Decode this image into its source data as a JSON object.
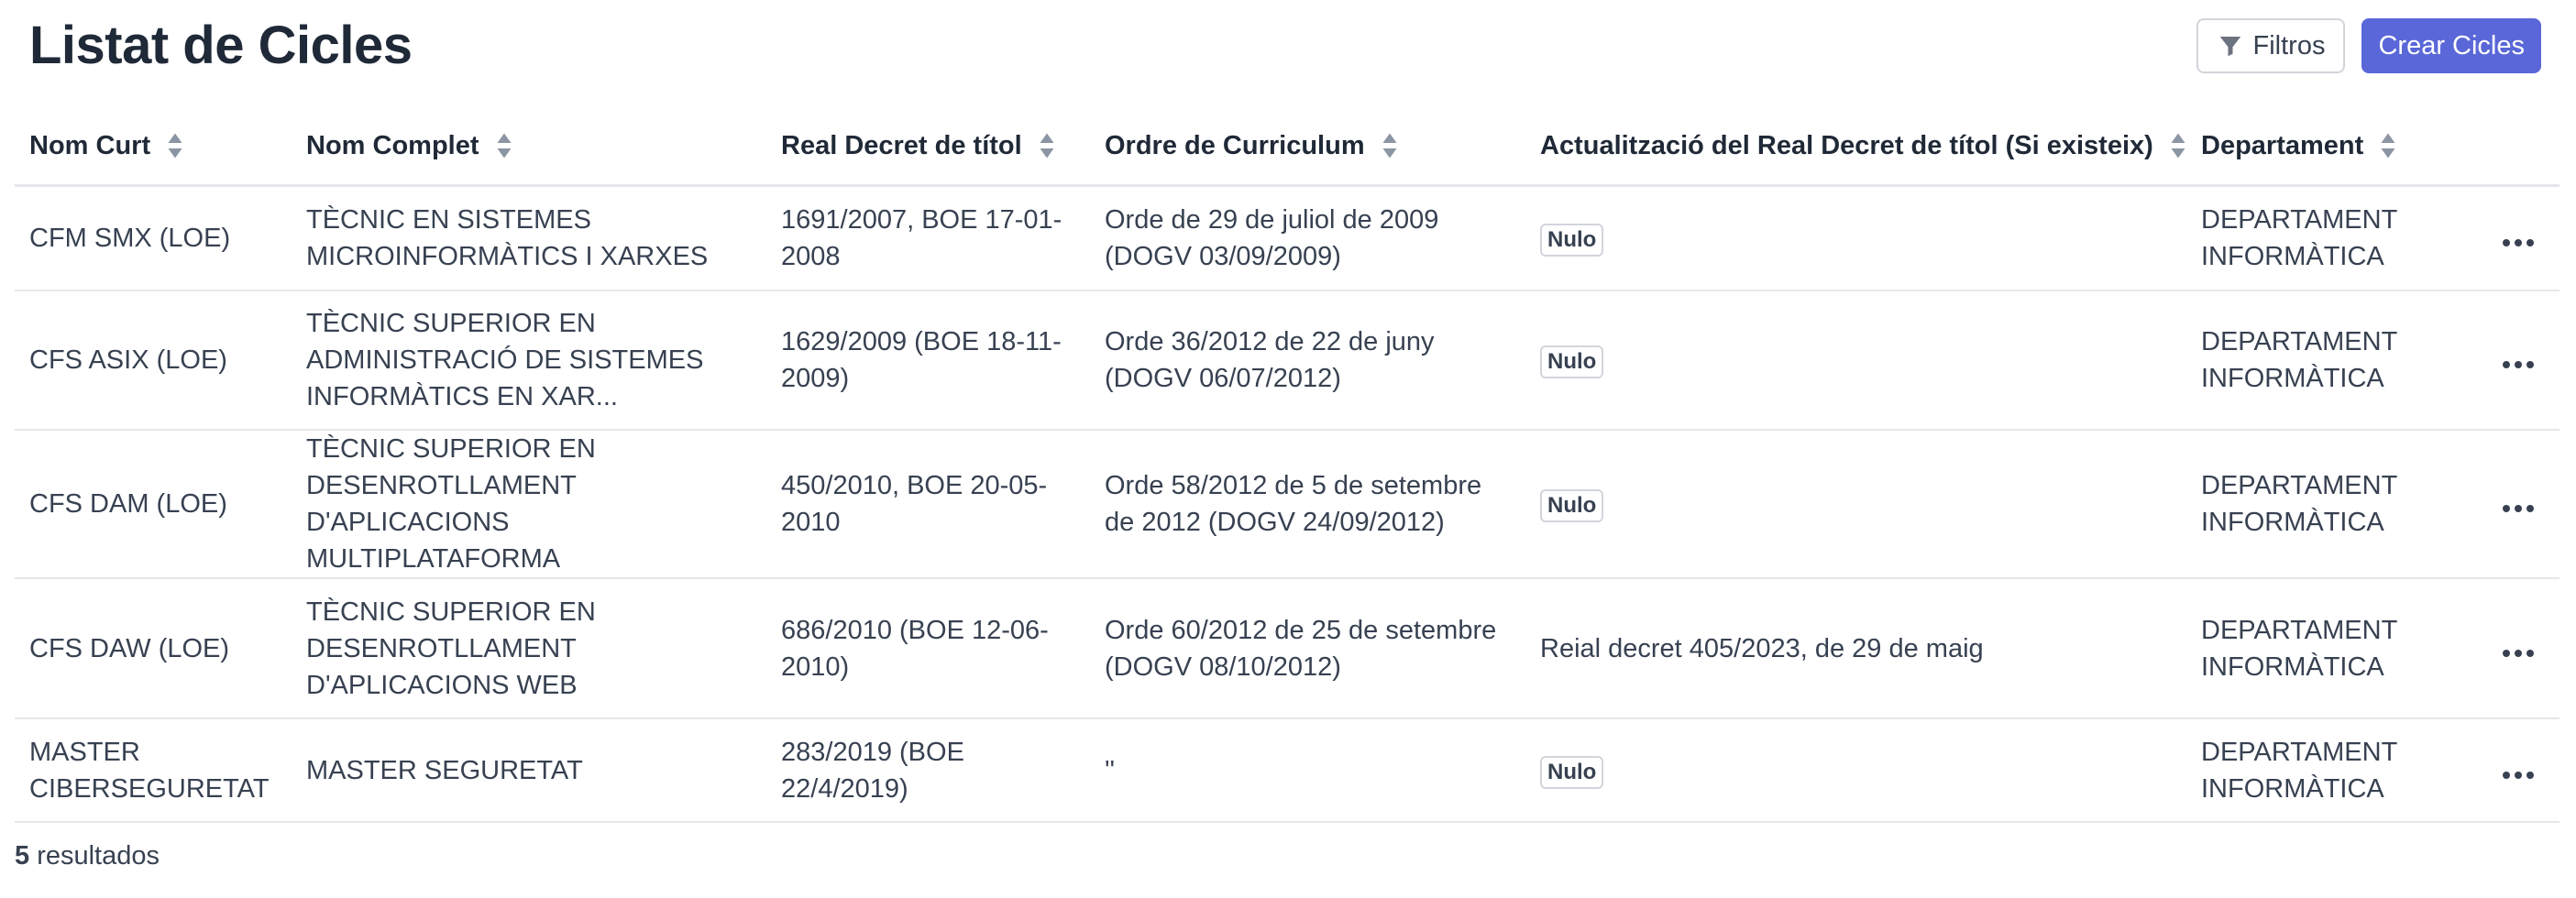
{
  "header": {
    "title": "Listat de Cicles",
    "filter_label": "Filtros",
    "create_label": "Crear Cicles"
  },
  "table": {
    "columns": [
      "Nom Curt",
      "Nom Complet",
      "Real Decret de títol",
      "Ordre de Curriculum",
      "Actualització del Real Decret de títol (Si existeix)",
      "Departament"
    ],
    "rows": [
      {
        "nom_curt": "CFM SMX (LOE)",
        "nom_complet": "TÈCNIC EN SISTEMES MICROINFORMÀTICS I XARXES",
        "real_decret": "1691/2007, BOE 17-01-2008",
        "ordre": "Orde de 29 de juliol de 2009 (DOGV 03/09/2009)",
        "actualitzacio": "Nulo",
        "actualitzacio_is_badge": true,
        "departament": "DEPARTAMENT INFORMÀTICA"
      },
      {
        "nom_curt": "CFS ASIX (LOE)",
        "nom_complet": "TÈCNIC SUPERIOR EN ADMINISTRACIÓ DE SISTEMES INFORMÀTICS EN XAR...",
        "real_decret": "1629/2009 (BOE 18-11-2009)",
        "ordre": "Orde 36/2012 de 22 de juny (DOGV 06/07/2012)",
        "actualitzacio": "Nulo",
        "actualitzacio_is_badge": true,
        "departament": "DEPARTAMENT INFORMÀTICA"
      },
      {
        "nom_curt": "CFS DAM (LOE)",
        "nom_complet": "TÈCNIC SUPERIOR EN DESENROTLLAMENT D'APLICACIONS MULTIPLATAFORMA",
        "real_decret": "450/2010, BOE 20-05-2010",
        "ordre": "Orde 58/2012 de 5 de setembre de 2012 (DOGV 24/09/2012)",
        "actualitzacio": "Nulo",
        "actualitzacio_is_badge": true,
        "departament": "DEPARTAMENT INFORMÀTICA"
      },
      {
        "nom_curt": "CFS DAW (LOE)",
        "nom_complet": "TÈCNIC SUPERIOR EN DESENROTLLAMENT D'APLICACIONS WEB",
        "real_decret": "686/2010 (BOE 12-06-2010)",
        "ordre": "Orde 60/2012 de 25 de setembre (DOGV 08/10/2012)",
        "actualitzacio": "Reial decret 405/2023, de 29 de maig",
        "actualitzacio_is_badge": false,
        "departament": "DEPARTAMENT INFORMÀTICA"
      },
      {
        "nom_curt": "MASTER CIBERSEGURETAT",
        "nom_complet": "MASTER SEGURETAT",
        "real_decret": "283/2019 (BOE 22/4/2019)",
        "ordre": "''",
        "actualitzacio": "Nulo",
        "actualitzacio_is_badge": true,
        "departament": "DEPARTAMENT INFORMÀTICA"
      }
    ]
  },
  "footer": {
    "count": "5",
    "label": " resultados"
  },
  "icons": {
    "filter": "filter-icon",
    "sort": "sort-icon",
    "row_actions": "ellipsis-icon"
  },
  "colors": {
    "primary": "#5a67d8",
    "text": "#1f2937",
    "border": "#e5e7eb"
  }
}
